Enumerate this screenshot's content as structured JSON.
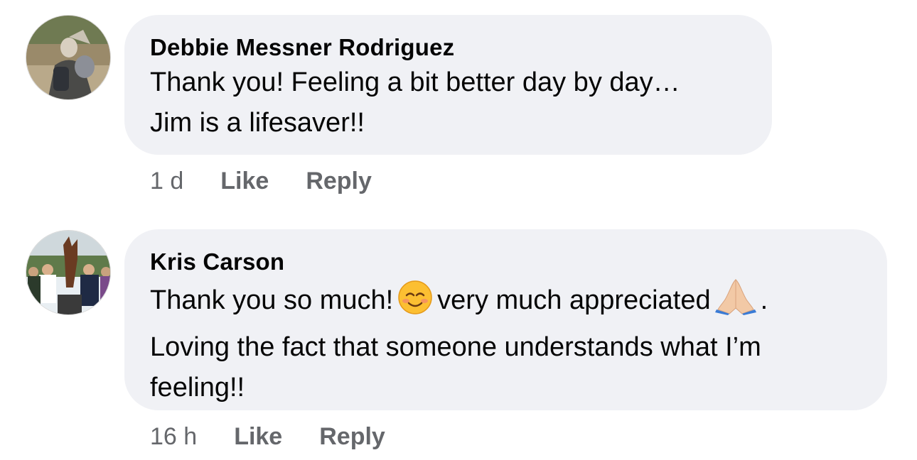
{
  "comments": [
    {
      "author": "Debbie Messner Rodriguez",
      "text_lines": [
        "Thank you! Feeling a bit better day by day…",
        "Jim is a lifesaver!!"
      ],
      "time": "1 d",
      "like_label": "Like",
      "reply_label": "Reply",
      "avatar_icon": "profile-photo-icon"
    },
    {
      "author": "Kris Carson",
      "line1_part1": "Thank you so much!",
      "line1_part2": "very much appreciated",
      "line1_end": ".",
      "text_lines_rest": [
        "Loving the fact that someone understands what I’m",
        "feeling!!"
      ],
      "emojis": [
        "smiling-face-emoji",
        "folded-hands-emoji"
      ],
      "time": "16 h",
      "like_label": "Like",
      "reply_label": "Reply",
      "avatar_icon": "profile-photo-icon"
    }
  ],
  "colors": {
    "bubble": "#f0f1f5",
    "meta_text": "#65676b",
    "body_text": "#050505"
  }
}
